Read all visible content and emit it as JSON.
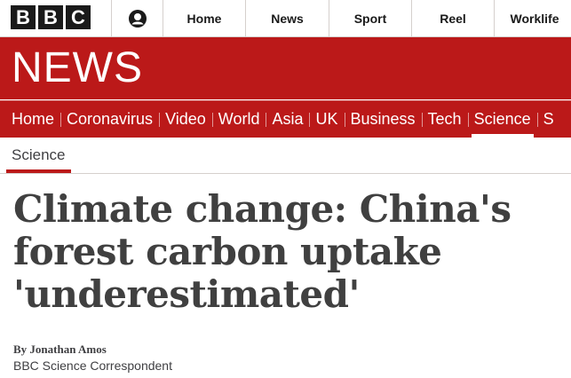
{
  "masthead": {
    "logo_letters": [
      "B",
      "B",
      "C"
    ],
    "account_icon": "user-icon",
    "nav": [
      "Home",
      "News",
      "Sport",
      "Reel",
      "Worklife"
    ]
  },
  "banner": {
    "title": "NEWS",
    "color": "#bb1919"
  },
  "section_nav": {
    "links": [
      "Home",
      "Coronavirus",
      "Video",
      "World",
      "Asia",
      "UK",
      "Business",
      "Tech",
      "Science",
      "S"
    ],
    "active": "Science"
  },
  "subnav": {
    "label": "Science"
  },
  "article": {
    "headline": "Climate change: China's forest carbon uptake 'underestimated'",
    "author": "By Jonathan Amos",
    "role": "BBC Science Correspondent"
  }
}
